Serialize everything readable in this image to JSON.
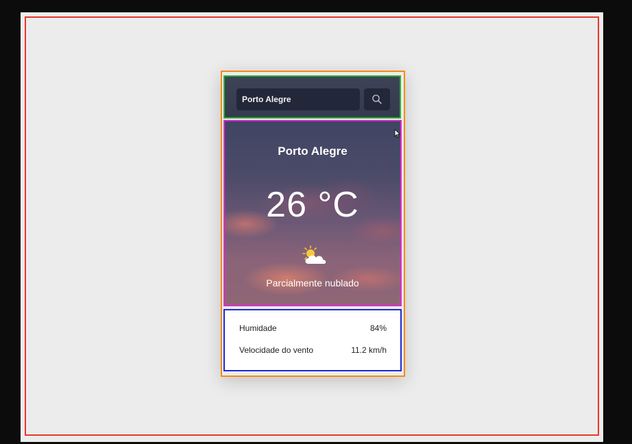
{
  "search": {
    "value": "Porto Alegre"
  },
  "weather": {
    "city": "Porto Alegre",
    "temperature": "26 °C",
    "condition": "Parcialmente nublado",
    "icon": "partly-cloudy-icon"
  },
  "details": {
    "humidity_label": "Humidade",
    "humidity_value": "84%",
    "wind_label": "Velocidade do vento",
    "wind_value": "11.2 km/h"
  },
  "colors": {
    "outer_outline": "#e8352a",
    "card_outline": "#f38b12",
    "search_outline": "#22b528",
    "weather_outline": "#e02ad4",
    "details_outline": "#1a2bd6"
  }
}
